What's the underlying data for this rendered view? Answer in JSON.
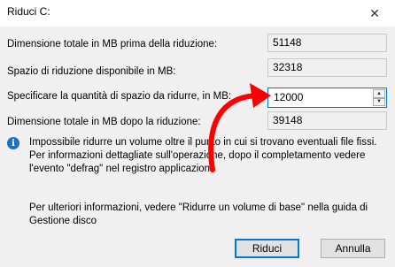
{
  "window": {
    "title": "Riduci C:",
    "close_glyph": "✕"
  },
  "fields": {
    "total_before": {
      "label": "Dimensione totale in MB prima della riduzione:",
      "value": "51148"
    },
    "available": {
      "label": "Spazio di riduzione disponibile in MB:",
      "value": "32318"
    },
    "amount": {
      "label": "Specificare la quantità di spazio da ridurre, in MB:",
      "value": "12000"
    },
    "total_after": {
      "label": "Dimensione totale in MB dopo la riduzione:",
      "value": "39148"
    }
  },
  "spinner": {
    "up": "▲",
    "down": "▼"
  },
  "info": {
    "icon": "info-icon",
    "icon_glyph": "i",
    "text": "Impossibile ridurre un volume oltre il punto in cui si trovano eventuali file fissi. Per informazioni dettagliate sull'operazione, dopo il completamento vedere l'evento \"defrag\" nel registro applicazioni."
  },
  "more_info": "Per ulteriori informazioni, vedere \"Ridurre un volume di base\" nella guida di Gestione disco",
  "buttons": {
    "shrink": "Riduci",
    "cancel": "Annulla"
  },
  "colors": {
    "accent": "#0078d7",
    "annotation_arrow": "#ff0000",
    "info_icon": "#1b72c4"
  }
}
